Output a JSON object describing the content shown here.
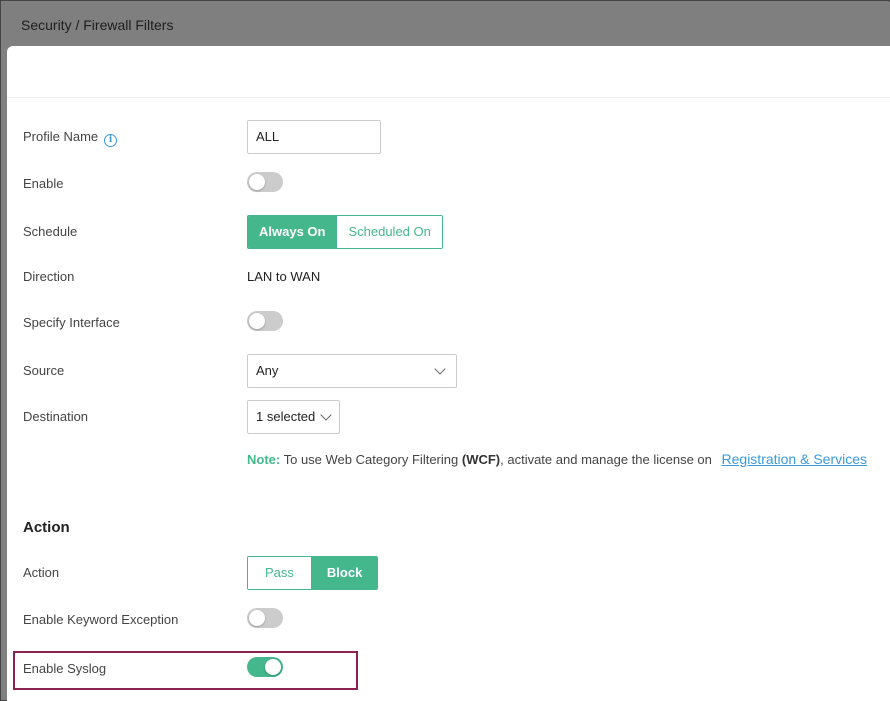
{
  "breadcrumb": "Security / Firewall Filters",
  "form": {
    "profile_name": {
      "label": "Profile Name",
      "value": "ALL",
      "info_icon": "info-icon"
    },
    "enable": {
      "label": "Enable",
      "on": false
    },
    "schedule": {
      "label": "Schedule",
      "options": [
        "Always On",
        "Scheduled On"
      ],
      "selected": "Always On"
    },
    "direction": {
      "label": "Direction",
      "value": "LAN to WAN"
    },
    "specify_interface": {
      "label": "Specify Interface",
      "on": false
    },
    "source": {
      "label": "Source",
      "value": "Any"
    },
    "destination": {
      "label": "Destination",
      "value": "1 selected"
    },
    "note": {
      "label": "Note:",
      "text_before": "To use Web Category Filtering",
      "bold": "(WCF)",
      "text_after": ", activate and manage the license on",
      "link": "Registration & Services"
    }
  },
  "action_section": {
    "title": "Action",
    "action": {
      "label": "Action",
      "options": [
        "Pass",
        "Block"
      ],
      "selected": "Block"
    },
    "keyword_exception": {
      "label": "Enable Keyword Exception",
      "on": false
    },
    "syslog": {
      "label": "Enable Syslog",
      "on": true
    }
  },
  "colors": {
    "accent": "#44b88c",
    "link": "#3a9ad9",
    "highlight_border": "#8b2252",
    "toggle_off": "#cccccc"
  }
}
